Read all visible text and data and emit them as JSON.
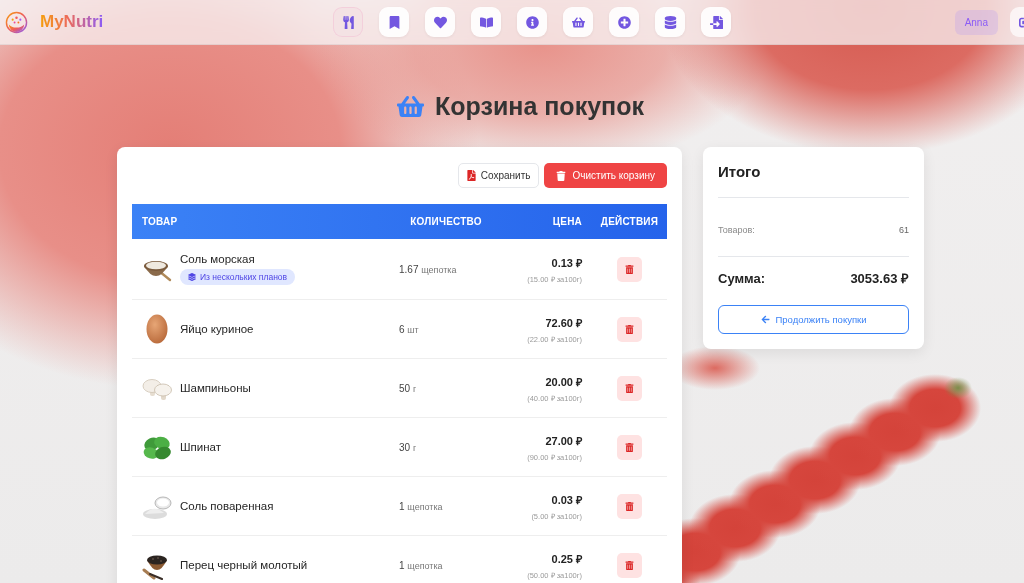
{
  "header": {
    "brand": "MyNutri",
    "nav": [
      {
        "selected": true
      },
      {
        "selected": false
      },
      {
        "selected": false
      },
      {
        "selected": false
      },
      {
        "selected": false
      },
      {
        "selected": false
      },
      {
        "selected": false
      },
      {
        "selected": false
      },
      {
        "selected": false
      }
    ],
    "user": "Anna"
  },
  "page_title": "Корзина покупок",
  "cart": {
    "toolbar": {
      "save": "Сохранить",
      "clear": "Очистить корзину"
    },
    "columns": [
      "ТОВАР",
      "КОЛИЧЕСТВО",
      "ЦЕНА",
      "ДЕЙСТВИЯ"
    ],
    "rows": [
      {
        "name": "Соль морская",
        "badge": "Из нескольких планов",
        "amount": "1.67",
        "unit": "щепотка",
        "price": "0.13 ₽",
        "unit_price": "(15.00 ₽ за100г)"
      },
      {
        "name": "Яйцо куриное",
        "amount": "6",
        "unit": "шт",
        "price": "72.60 ₽",
        "unit_price": "(22.00 ₽ за100г)"
      },
      {
        "name": "Шампиньоны",
        "amount": "50",
        "unit": "г",
        "price": "20.00 ₽",
        "unit_price": "(40.00 ₽ за100г)"
      },
      {
        "name": "Шпинат",
        "amount": "30",
        "unit": "г",
        "price": "27.00 ₽",
        "unit_price": "(90.00 ₽ за100г)"
      },
      {
        "name": "Соль поваренная",
        "amount": "1",
        "unit": "щепотка",
        "price": "0.03 ₽",
        "unit_price": "(5.00 ₽ за100г)"
      },
      {
        "name": "Перец черный молотый",
        "amount": "1",
        "unit": "щепотка",
        "price": "0.25 ₽",
        "unit_price": "(50.00 ₽ за100г)"
      }
    ]
  },
  "summary": {
    "title": "Итого",
    "count_label": "Товаров:",
    "count": "61",
    "total_label": "Сумма:",
    "total": "3053.63 ₽",
    "continue": "Продолжить покупки"
  }
}
